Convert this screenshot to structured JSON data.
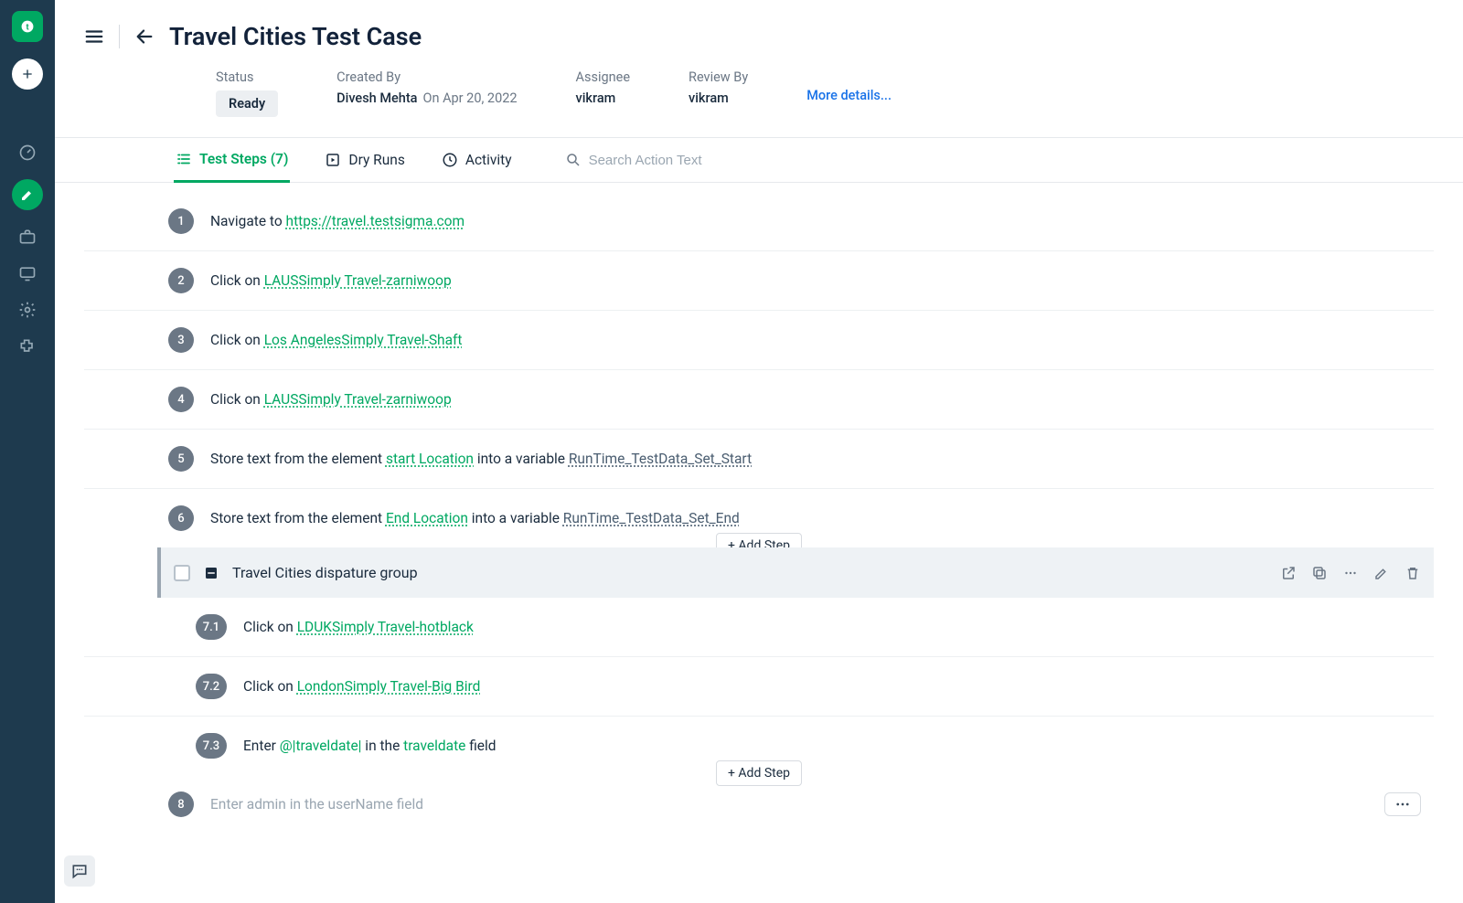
{
  "page": {
    "title": "Travel Cities Test Case"
  },
  "meta": {
    "status_label": "Status",
    "status_value": "Ready",
    "created_by_label": "Created By",
    "created_by_name": "Divesh Mehta",
    "created_by_date": "On Apr 20, 2022",
    "assignee_label": "Assignee",
    "assignee_value": "vikram",
    "review_label": "Review By",
    "review_value": "vikram",
    "more_details": "More details..."
  },
  "tabs": {
    "test_steps": "Test Steps (7)",
    "dry_runs": "Dry Runs",
    "activity": "Activity",
    "search_placeholder": "Search Action Text"
  },
  "steps": [
    {
      "n": "1",
      "pre": "Navigate to ",
      "link": "https://travel.testsigma.com"
    },
    {
      "n": "2",
      "pre": "Click on ",
      "link": "LAUSSimply Travel-zarniwoop"
    },
    {
      "n": "3",
      "pre": "Click on ",
      "link": "Los AngelesSimply Travel-Shaft"
    },
    {
      "n": "4",
      "pre": "Click on ",
      "link": "LAUSSimply Travel-zarniwoop"
    },
    {
      "n": "5",
      "pre": "Store text from the element ",
      "link": "start Location",
      "mid": " into a variable ",
      "var": "RunTime_TestData_Set_Start"
    },
    {
      "n": "6",
      "pre": "Store text from the element ",
      "link": "End Location",
      "mid": " into a variable ",
      "var": "RunTime_TestData_Set_End"
    }
  ],
  "group": {
    "title": "Travel Cities dispature group"
  },
  "substeps": [
    {
      "n": "7.1",
      "pre": "Click on ",
      "link": "LDUKSimply Travel-hotblack"
    },
    {
      "n": "7.2",
      "pre": "Click on ",
      "link": "LondonSimply Travel-Big Bird"
    },
    {
      "n": "7.3",
      "pre": "Enter ",
      "param": "@|traveldate|",
      "mid": " in the ",
      "param2": "traveldate",
      "post": " field"
    }
  ],
  "add_step_label": "+ Add Step",
  "new_step": {
    "n": "8",
    "placeholder": "Enter admin in the userName field"
  }
}
